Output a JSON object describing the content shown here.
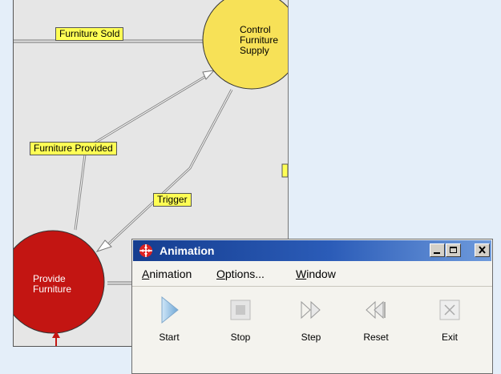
{
  "diagram": {
    "flows": {
      "furniture_sold": "Furniture Sold",
      "furniture_provided": "Furniture Provided",
      "trigger": "Trigger"
    },
    "nodes": {
      "control": "Control\nFurniture\nSupply",
      "provide": "Provide\nFurniture"
    },
    "colors": {
      "control_node": "#f7e157",
      "provide_node": "#c31512",
      "flow_label": "#ffff55"
    }
  },
  "window": {
    "title": "Animation",
    "menu": {
      "animation": {
        "first": "A",
        "rest": "nimation"
      },
      "options": {
        "first": "O",
        "rest": "ptions..."
      },
      "window": {
        "first": "W",
        "rest": "indow"
      }
    },
    "tools": [
      "Start",
      "Stop",
      "Step",
      "Reset",
      "Exit"
    ],
    "icons": [
      "minimize-icon",
      "maximize-icon",
      "close-icon"
    ]
  }
}
